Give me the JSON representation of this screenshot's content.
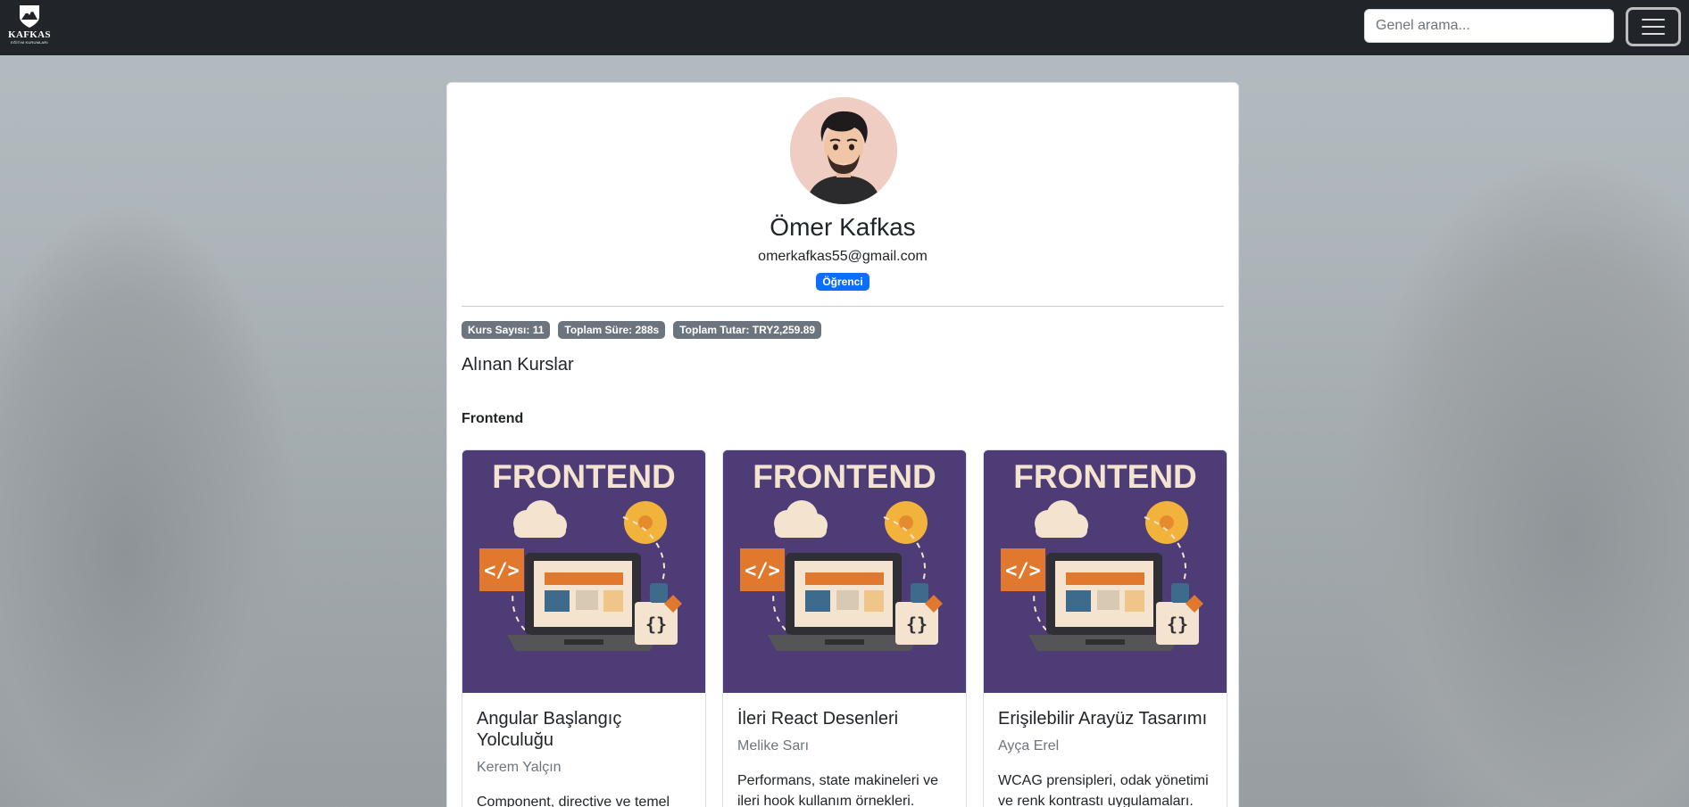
{
  "navbar": {
    "brand_name": "KAFKAS",
    "brand_sub": "EĞİTİM KURUMLARI",
    "search_placeholder": "Genel arama..."
  },
  "profile": {
    "name": "Ömer Kafkas",
    "email": "omerkafkas55@gmail.com",
    "role": "Öğrenci",
    "stats": [
      "Kurs Sayısı: 11",
      "Toplam Süre: 288s",
      "Toplam Tutar: TRY2,259.89"
    ]
  },
  "section_title": "Alınan Kurslar",
  "category": "Frontend",
  "courses": [
    {
      "thumb_text": "FRONTEND",
      "title": "Angular Başlangıç Yolculuğu",
      "author": "Kerem Yalçın",
      "desc": "Component, directive ve temel"
    },
    {
      "thumb_text": "FRONTEND",
      "title": "İleri React Desenleri",
      "author": "Melike Sarı",
      "desc": "Performans, state makineleri ve ileri hook kullanım örnekleri."
    },
    {
      "thumb_text": "FRONTEND",
      "title": "Erişilebilir Arayüz Tasarımı",
      "author": "Ayça Erel",
      "desc": "WCAG prensipleri, odak yönetimi ve renk kontrastı uygulamaları."
    }
  ],
  "colors": {
    "navbar": "#212529",
    "primary_badge": "#0d6efd",
    "secondary_badge": "#6c757d",
    "thumb_bg": "#4e3c77",
    "thumb_text": "#f3e3cf",
    "thumb_orange": "#e0782d"
  }
}
